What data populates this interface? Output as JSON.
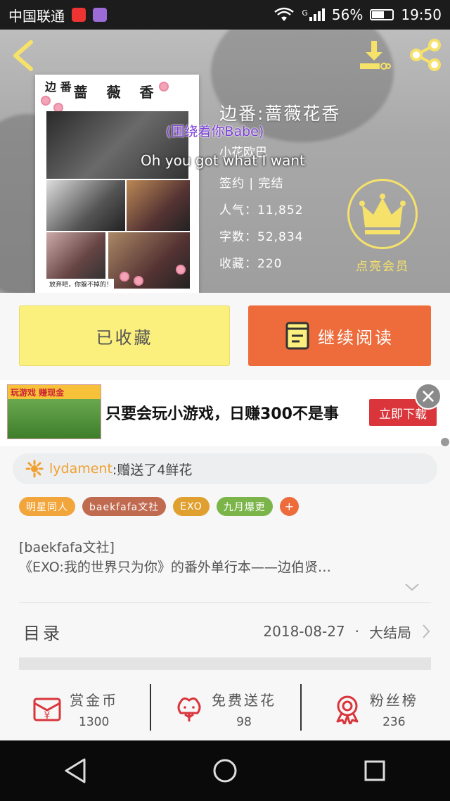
{
  "status_bar": {
    "carrier": "中国联通",
    "network": "G",
    "battery": "56%",
    "battery_level": 0.56,
    "time": "19:50"
  },
  "header": {
    "cover": {
      "side_text": "边 番",
      "title_text": "蔷 薇  香",
      "caption": "放弃吧，你躲不掉的！"
    },
    "book_title": "边番:蔷薇花香",
    "author": "小花欧巴",
    "status_line": "签约 | 完结",
    "popularity_label": "人气：",
    "popularity_value": "11,852",
    "word_count_label": "字数：",
    "word_count_value": "52,834",
    "favorites_label": "收藏：",
    "favorites_value": "220",
    "vip_label": "点亮会员",
    "lyric_cn": "(围绕着你Babe)",
    "lyric_en": "Oh you got what I want"
  },
  "actions": {
    "collected_label": "已收藏",
    "continue_label": "继续阅读"
  },
  "ad": {
    "image_text": "玩游戏 赚现金",
    "text": "只要会玩小游戏，日赚300不是事",
    "button_label": "立即下载"
  },
  "gift": {
    "user": "lydament",
    "message": ":赠送了4鲜花"
  },
  "tags": [
    {
      "label": "明星同人",
      "color": "#f2a53a"
    },
    {
      "label": "baekfafa文社",
      "color": "#c06a50"
    },
    {
      "label": "EXO",
      "color": "#e0a030"
    },
    {
      "label": "九月爆更",
      "color": "#7bb54a"
    }
  ],
  "tag_plus": "+",
  "description": {
    "line1": "[baekfafa文社]",
    "line2": "《EXO:我的世界只为你》的番外单行本——边伯贤…"
  },
  "toc": {
    "label": "目录",
    "date": "2018-08-27",
    "separator": "·",
    "status": "大结局"
  },
  "stats": [
    {
      "label": "赏金币",
      "value": "1300",
      "icon": "reward-coin-icon"
    },
    {
      "label": "免费送花",
      "value": "98",
      "icon": "flower-icon"
    },
    {
      "label": "粉丝榜",
      "value": "236",
      "icon": "medal-icon"
    }
  ],
  "colors": {
    "accent_orange": "#ee6b3b",
    "accent_yellow": "#fbef7d",
    "vip_gold": "#f6e26a",
    "icon_red": "#d9353b"
  }
}
